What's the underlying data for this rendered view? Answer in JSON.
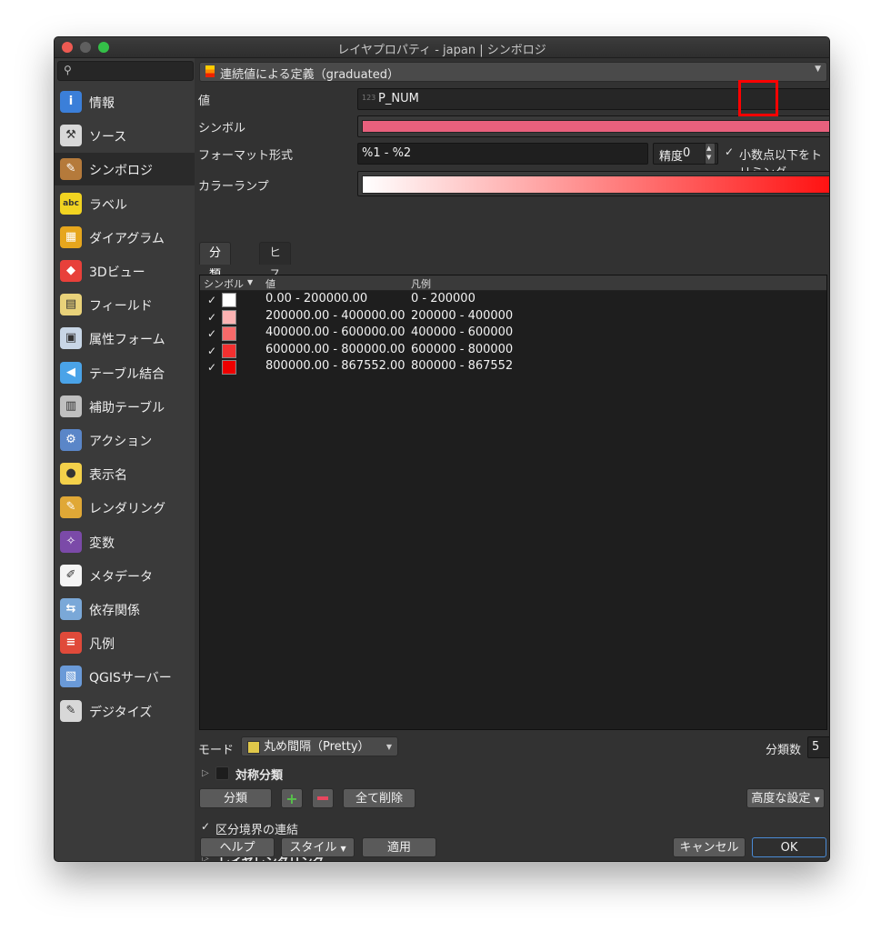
{
  "window": {
    "title": "レイヤプロパティ - japan | シンボロジ"
  },
  "sidebar": {
    "search_icon": "search-icon",
    "items": [
      {
        "label": "情報",
        "icon": "info-icon",
        "color": "#3b7fd9"
      },
      {
        "label": "ソース",
        "icon": "source-wrench-icon",
        "color": "#d8d8d8"
      },
      {
        "label": "シンボロジ",
        "icon": "symbology-brush-icon",
        "color": "#b57a3b"
      },
      {
        "label": "ラベル",
        "icon": "label-abc-icon",
        "color": "#f1d321"
      },
      {
        "label": "ダイアグラム",
        "icon": "diagram-icon",
        "color": "#e6a61d"
      },
      {
        "label": "3Dビュー",
        "icon": "3d-cube-icon",
        "color": "#e8403a"
      },
      {
        "label": "フィールド",
        "icon": "fields-icon",
        "color": "#e9d27a"
      },
      {
        "label": "属性フォーム",
        "icon": "attribute-form-icon",
        "color": "#c8d6e6"
      },
      {
        "label": "テーブル結合",
        "icon": "join-icon",
        "color": "#4aa3e8"
      },
      {
        "label": "補助テーブル",
        "icon": "auxiliary-storage-icon",
        "color": "#bfbfbf"
      },
      {
        "label": "アクション",
        "icon": "action-gear-icon",
        "color": "#5a86c8"
      },
      {
        "label": "表示名",
        "icon": "display-name-bubble-icon",
        "color": "#f3d04a"
      },
      {
        "label": "レンダリング",
        "icon": "rendering-brush-icon",
        "color": "#e0a836"
      },
      {
        "label": "変数",
        "icon": "variables-icon",
        "color": "#7b4aa8"
      },
      {
        "label": "メタデータ",
        "icon": "metadata-icon",
        "color": "#f4f4f4"
      },
      {
        "label": "依存関係",
        "icon": "dependencies-icon",
        "color": "#7aa8d8"
      },
      {
        "label": "凡例",
        "icon": "legend-icon",
        "color": "#e04a3a"
      },
      {
        "label": "QGISサーバー",
        "icon": "qgis-server-icon",
        "color": "#6a9ad8"
      },
      {
        "label": "デジタイズ",
        "icon": "digitizing-icon",
        "color": "#d8d8d8"
      }
    ],
    "active_index": 2
  },
  "renderer": {
    "label": "連続値による定義（graduated）"
  },
  "value_field": {
    "label": "値",
    "badge": "123",
    "value": "P_NUM"
  },
  "symbol": {
    "label": "シンボル",
    "color": "#e9607d"
  },
  "format": {
    "label": "フォーマット形式",
    "value": "%1 - %2",
    "precision_label": "精度",
    "precision_value": "0",
    "trim_label": "小数点以下をトリミング",
    "trim_checked": true
  },
  "color_ramp": {
    "label": "カラーランプ",
    "from": "#ffffff",
    "to": "#ff0000"
  },
  "tabs": [
    {
      "label": "分類数"
    },
    {
      "label": "ヒストグラム"
    }
  ],
  "table": {
    "headers": {
      "symbol": "シンボル",
      "value": "値",
      "legend": "凡例"
    },
    "rows": [
      {
        "checked": true,
        "color": "#ffffff",
        "value": "0.00 - 200000.00",
        "legend": "0 - 200000"
      },
      {
        "checked": true,
        "color": "#fbb3b3",
        "value": "200000.00 - 400000.00",
        "legend": "200000 - 400000"
      },
      {
        "checked": true,
        "color": "#f76a6a",
        "value": "400000.00 - 600000.00",
        "legend": "400000 - 600000"
      },
      {
        "checked": true,
        "color": "#f33030",
        "value": "600000.00 - 800000.00",
        "legend": "600000 - 800000"
      },
      {
        "checked": true,
        "color": "#ee0000",
        "value": "800000.00 - 867552.00",
        "legend": "800000 - 867552"
      }
    ]
  },
  "mode": {
    "label": "モード",
    "value": "丸め間隔（Pretty）"
  },
  "classes": {
    "label": "分類数",
    "value": "5"
  },
  "symmetric": {
    "label": "対称分類"
  },
  "buttons": {
    "classify": "分類",
    "delete_all": "全て削除",
    "advanced": "高度な設定",
    "help": "ヘルプ",
    "style": "スタイル",
    "apply": "適用",
    "cancel": "キャンセル",
    "ok": "OK"
  },
  "link_boundaries": {
    "label": "区分境界の連結",
    "checked": true
  },
  "layer_rendering": {
    "label": "レイヤレンダリング"
  }
}
